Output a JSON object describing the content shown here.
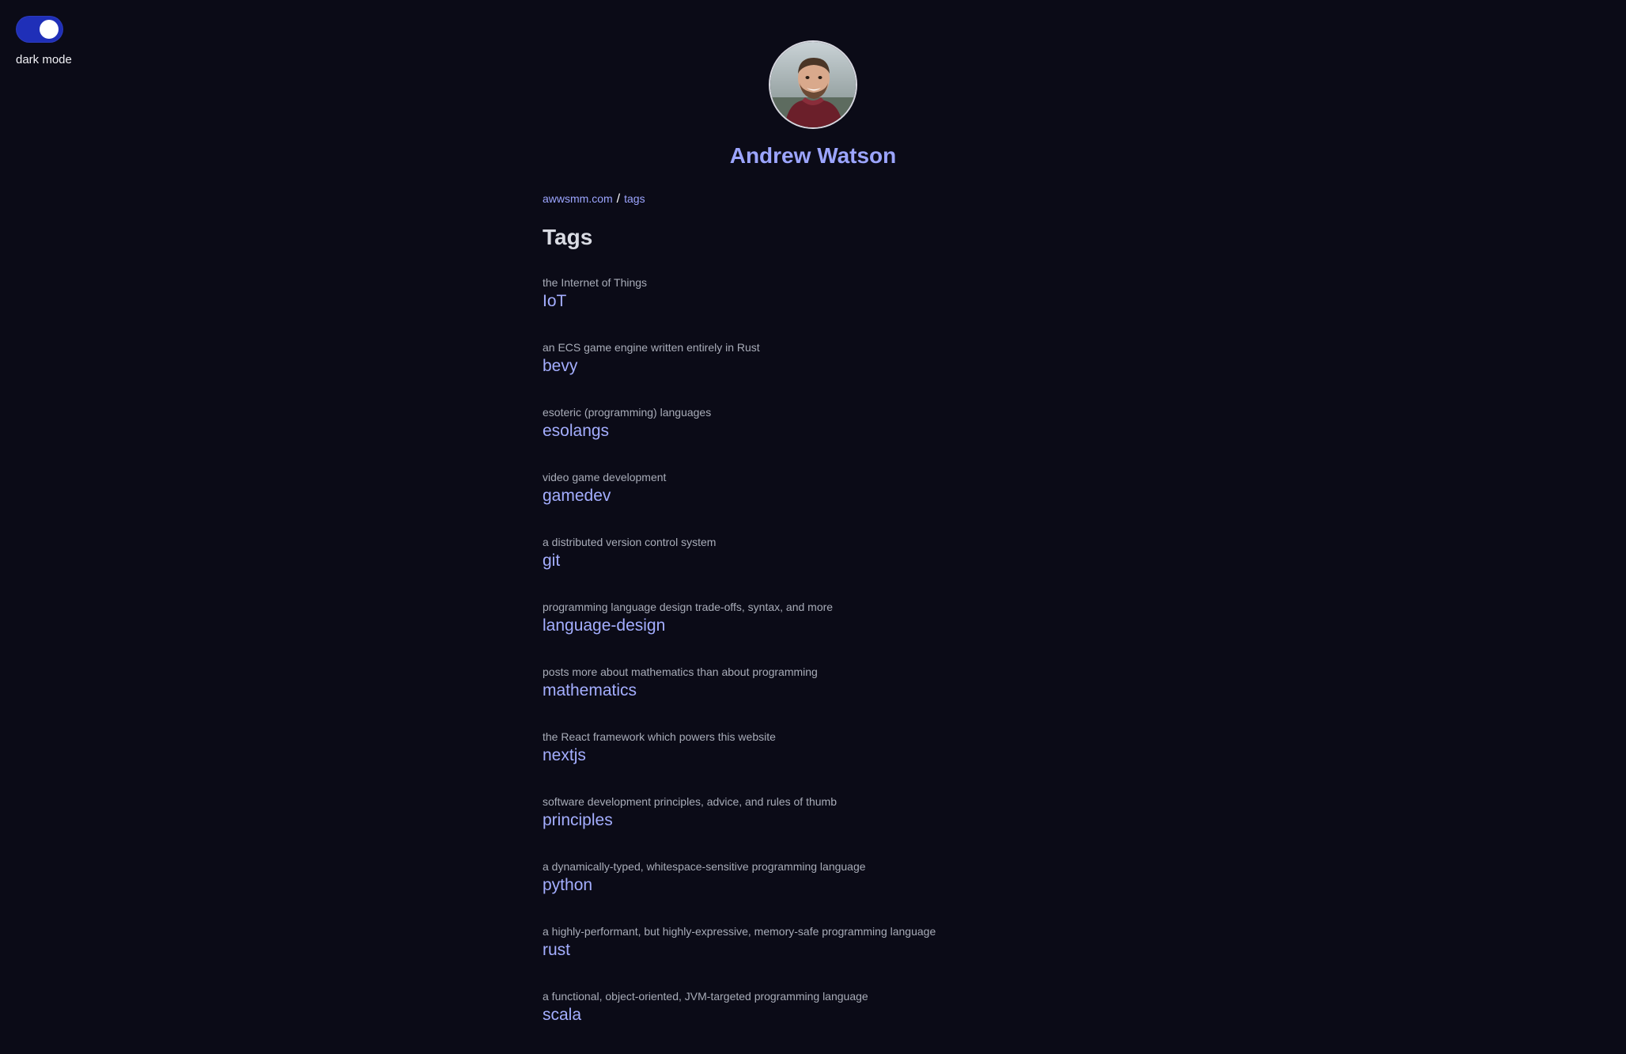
{
  "theme_toggle": {
    "label": "dark mode",
    "state": "on",
    "track_color": "#1f2fb8",
    "knob_color": "#ffffff"
  },
  "header": {
    "avatar_alt": "Andrew Watson",
    "name": "Andrew Watson",
    "name_color": "#9ca5ff"
  },
  "breadcrumb": {
    "home": "awwsmm.com",
    "separator": "/",
    "current": "tags"
  },
  "page": {
    "title": "Tags",
    "background": "#0b0b17",
    "link_color": "#a4aeff"
  },
  "tags": [
    {
      "description": "the Internet of Things",
      "name": "IoT"
    },
    {
      "description": "an ECS game engine written entirely in Rust",
      "name": "bevy"
    },
    {
      "description": "esoteric (programming) languages",
      "name": "esolangs"
    },
    {
      "description": "video game development",
      "name": "gamedev"
    },
    {
      "description": "a distributed version control system",
      "name": "git"
    },
    {
      "description": "programming language design trade-offs, syntax, and more",
      "name": "language-design"
    },
    {
      "description": "posts more about mathematics than about programming",
      "name": "mathematics"
    },
    {
      "description": "the React framework which powers this website",
      "name": "nextjs"
    },
    {
      "description": "software development principles, advice, and rules of thumb",
      "name": "principles"
    },
    {
      "description": "a dynamically-typed, whitespace-sensitive programming language",
      "name": "python"
    },
    {
      "description": "a highly-performant, but highly-expressive, memory-safe programming language",
      "name": "rust"
    },
    {
      "description": "a functional, object-oriented, JVM-targeted programming language",
      "name": "scala"
    }
  ]
}
